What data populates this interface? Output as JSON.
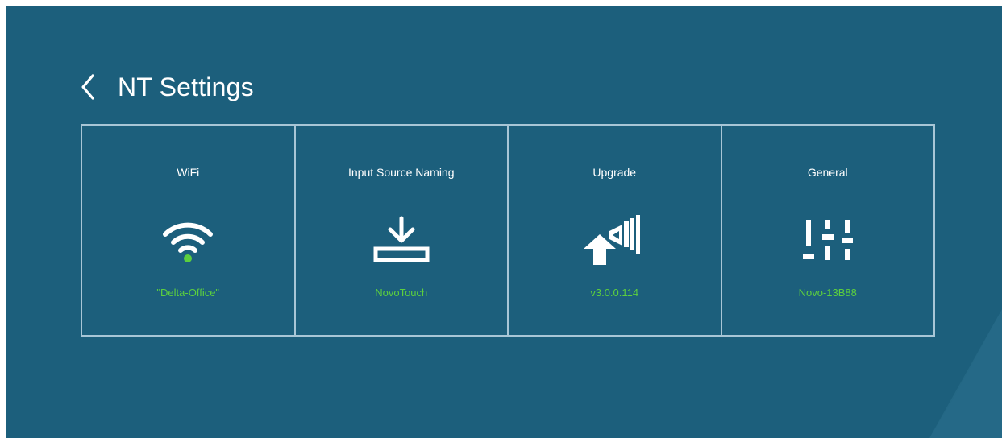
{
  "header": {
    "title": "NT Settings",
    "back_icon": "chevron-left-icon"
  },
  "tiles": [
    {
      "label": "WiFi",
      "value": "\"Delta-Office\"",
      "icon": "wifi-icon"
    },
    {
      "label": "Input Source Naming",
      "value": "NovoTouch",
      "icon": "input-source-icon"
    },
    {
      "label": "Upgrade",
      "value": "v3.0.0.114",
      "icon": "upgrade-icon"
    },
    {
      "label": "General",
      "value": "Novo-13B88",
      "icon": "sliders-icon"
    }
  ],
  "colors": {
    "background": "#1c5f7c",
    "border": "#a8c6d6",
    "value_text": "#5ccf3e",
    "text": "#ffffff"
  }
}
